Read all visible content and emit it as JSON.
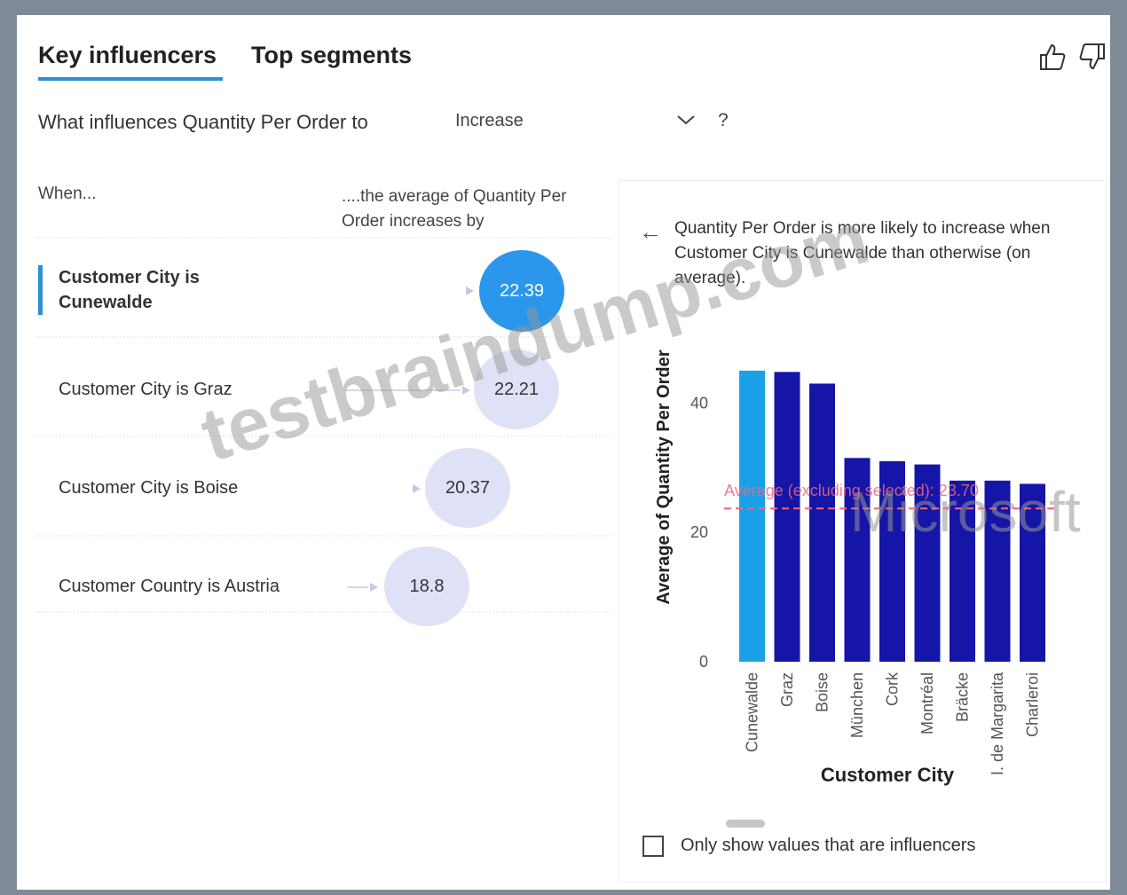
{
  "tabs": [
    {
      "label": "Key influencers",
      "active": true
    },
    {
      "label": "Top segments",
      "active": false
    }
  ],
  "feedback": {
    "thumbs_up_icon": "thumbs-up-icon",
    "thumbs_down_icon": "thumbs-down-icon"
  },
  "question": {
    "text": "What influences Quantity Per Order to",
    "dropdown_value": "Increase",
    "help": "?"
  },
  "influencers": {
    "when_label": "When...",
    "avg_label": "....the average of Quantity Per Order increases by",
    "items": [
      {
        "label": "Customer City is Cunewalde",
        "value": "22.39",
        "selected": true
      },
      {
        "label": "Customer City is Graz",
        "value": "22.21",
        "selected": false
      },
      {
        "label": "Customer City is Boise",
        "value": "20.37",
        "selected": false
      },
      {
        "label": "Customer Country is Austria",
        "value": "18.8",
        "selected": false
      }
    ]
  },
  "detail": {
    "back_icon": "back-arrow-icon",
    "description": "Quantity Per Order is more likely to increase when Customer City is Cunewalde than otherwise (on average).",
    "checkbox_label": "Only show values that are influencers",
    "checkbox_checked": false
  },
  "chart_data": {
    "type": "bar",
    "categories": [
      "Cunewalde",
      "Graz",
      "Boise",
      "München",
      "Cork",
      "Montréal",
      "Bräcke",
      "I. de Margarita",
      "Charleroi"
    ],
    "values": [
      45,
      44.8,
      43,
      31.5,
      31,
      30.5,
      28,
      28,
      27.5
    ],
    "highlighted": "Cunewalde",
    "ylabel": "Average of Quantity Per Order",
    "xlabel": "Customer City",
    "yticks": [
      0,
      20,
      40
    ],
    "ylim": [
      0,
      48
    ],
    "reference_line": {
      "label": "Average (excluding selected): 23.70",
      "value": 23.7
    },
    "colors": {
      "highlight": "#1aa0e8",
      "bar": "#1515a8",
      "reference": "#f2667a"
    }
  },
  "watermarks": {
    "site": "testbraindump.com",
    "brand": "Microsoft"
  }
}
